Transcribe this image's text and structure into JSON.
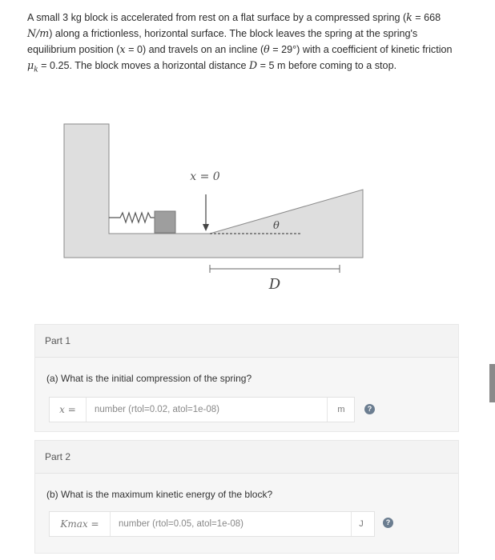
{
  "problem": {
    "text_1": "A small 3 kg block is accelerated from rest on a flat surface by a compressed spring (",
    "k_sym": "k",
    "text_2": " = 668 ",
    "unit_sym": "N/m",
    "text_3": ") along a frictionless, horizontal surface. The block leaves the spring at the spring's equilibrium position (",
    "x_sym": "x",
    "text_4": " = 0) and travels on an incline (",
    "theta_sym": "θ",
    "text_5": " = 29°) with a coefficient of kinetic friction ",
    "mu_sym": "μ",
    "mu_sub": "k",
    "text_6": " = 0.25. The block moves a horizontal distance ",
    "d_sym": "D",
    "text_7": " = 5 m before coming to a stop."
  },
  "figure": {
    "x0_label": "x = 0",
    "theta_label": "θ",
    "d_label": "D"
  },
  "parts": [
    {
      "header": "Part 1",
      "question": "(a) What is the initial compression of the spring?",
      "answer_label": "x =",
      "placeholder": "number (rtol=0.02, atol=1e-08)",
      "unit": "m"
    },
    {
      "header": "Part 2",
      "question": "(b) What is the maximum kinetic energy of the block?",
      "answer_label": "Kmax =",
      "placeholder": "number (rtol=0.05, atol=1e-08)",
      "unit": "J"
    }
  ],
  "icons": {
    "help": "question-circle-icon"
  },
  "colors": {
    "figure_fill": "#dedede",
    "figure_stroke": "#7a7a7a",
    "block": "#9e9e9e",
    "help_icon": "#6b7d90"
  }
}
